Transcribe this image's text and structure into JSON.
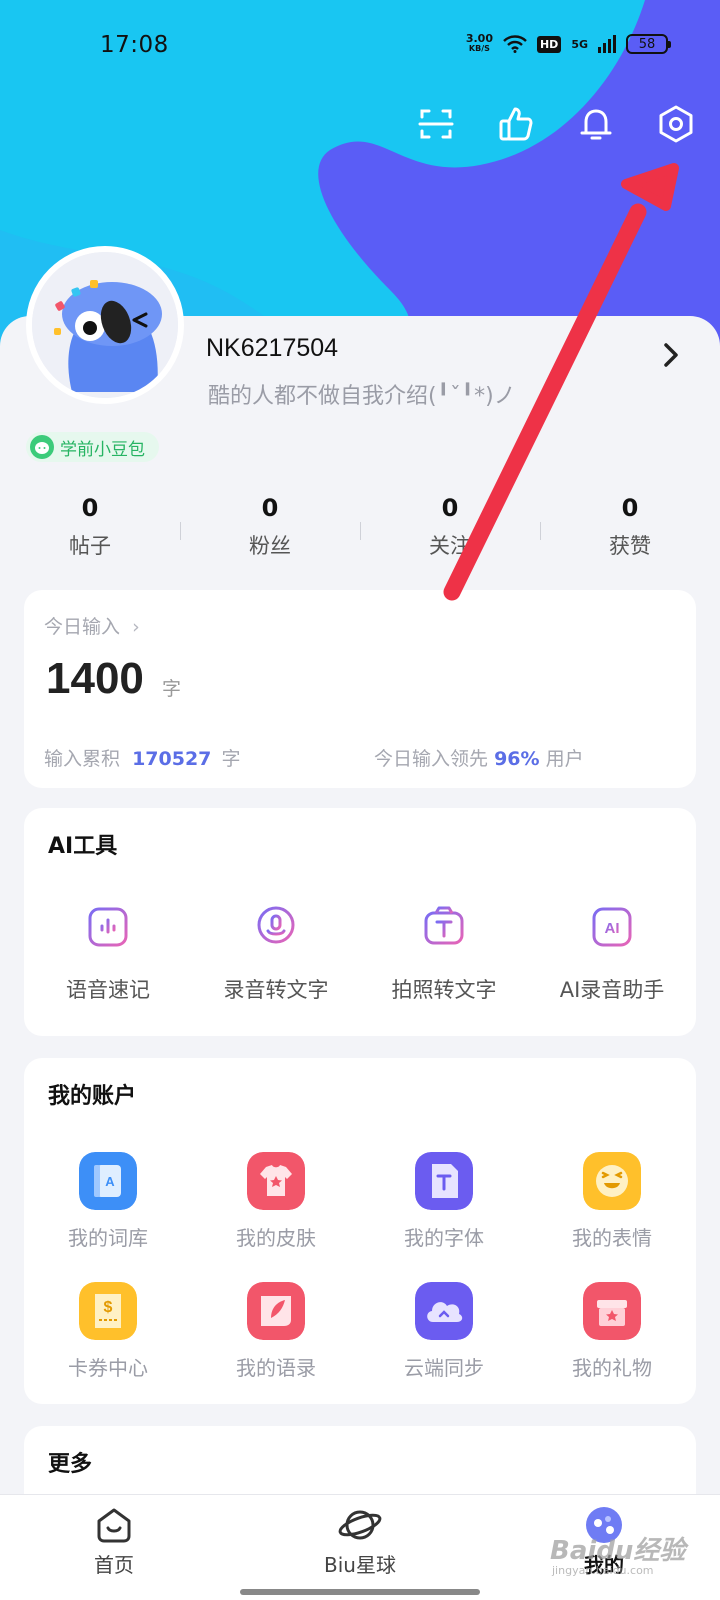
{
  "status_bar": {
    "time": "17:08",
    "net_speed_value": "3.00",
    "net_speed_unit": "KB/S",
    "hd": "HD",
    "network": "5G",
    "battery": "58"
  },
  "header_icons": [
    "scan-icon",
    "like-icon",
    "bell-icon",
    "settings-icon"
  ],
  "profile": {
    "username": "NK6217504",
    "bio": "酷的人都不做自我介绍(╹ˇ╹*)ノ",
    "badge": "学前小豆包"
  },
  "stats": [
    {
      "value": "0",
      "label": "帖子"
    },
    {
      "value": "0",
      "label": "粉丝"
    },
    {
      "value": "0",
      "label": "关注"
    },
    {
      "value": "0",
      "label": "获赞"
    }
  ],
  "today": {
    "title": "今日输入",
    "count": "1400",
    "unit": "字",
    "total_label": "输入累积",
    "total_value": "170527",
    "total_unit": "字",
    "lead_label": "今日输入领先",
    "lead_value": "96%",
    "lead_suffix": "用户"
  },
  "ai_tools": {
    "title": "AI工具",
    "items": [
      {
        "label": "语音速记",
        "icon": "voice-note-icon"
      },
      {
        "label": "录音转文字",
        "icon": "record-to-text-icon"
      },
      {
        "label": "拍照转文字",
        "icon": "photo-to-text-icon"
      },
      {
        "label": "AI录音助手",
        "icon": "ai-record-assistant-icon"
      }
    ]
  },
  "account": {
    "title": "我的账户",
    "items": [
      {
        "label": "我的词库",
        "icon": "lexicon-icon",
        "color": "#3d8ff7"
      },
      {
        "label": "我的皮肤",
        "icon": "skin-icon",
        "color": "#f2566a"
      },
      {
        "label": "我的字体",
        "icon": "font-icon",
        "color": "#6b5cf0"
      },
      {
        "label": "我的表情",
        "icon": "emoji-icon",
        "color": "#ffc02b"
      },
      {
        "label": "卡券中心",
        "icon": "coupon-icon",
        "color": "#ffc02b"
      },
      {
        "label": "我的语录",
        "icon": "quote-icon",
        "color": "#f2566a"
      },
      {
        "label": "云端同步",
        "icon": "cloud-sync-icon",
        "color": "#6b5cf0"
      },
      {
        "label": "我的礼物",
        "icon": "gift-icon",
        "color": "#f2566a"
      }
    ]
  },
  "more": {
    "title": "更多"
  },
  "nav": [
    {
      "label": "首页",
      "icon": "home-icon"
    },
    {
      "label": "Biu星球",
      "icon": "planet-icon"
    },
    {
      "label": "我的",
      "icon": "profile-icon"
    }
  ],
  "colors": {
    "hero_cyan": "#19c6f2",
    "hero_blue": "#5a5df6",
    "accent": "#5b6ee6",
    "arrow": "#ee3247"
  },
  "watermark": {
    "main": "Baidu经验",
    "sub": "jingyan.baidu.com"
  }
}
